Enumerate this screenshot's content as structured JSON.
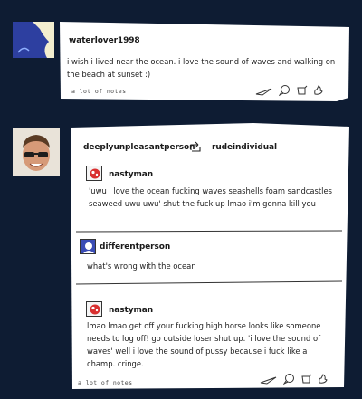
{
  "post1": {
    "username": "waterlover1998",
    "text": "i wish i lived near the ocean. i love the sound of waves and walking on the beach at sunset :)",
    "notes": "a lot of notes"
  },
  "post2": {
    "reblogger": "deeplyunpleasantperson",
    "source": "rudeindividual",
    "notes": "a lot of notes",
    "comments": [
      {
        "username": "nastyman",
        "text": "'uwu i love the ocean fucking waves seashells foam sandcastles seaweed uwu uwu' shut the fuck up lmao i'm gonna kill you"
      },
      {
        "username": "differentperson",
        "text": "what's wrong with the ocean"
      },
      {
        "username": "nastyman",
        "text": "lmao lmao get off your fucking high horse looks like someone needs to log off! go outside loser shut up. 'i love the sound of waves' well i love the sound of pussy because i fuck like a champ. cringe."
      }
    ]
  },
  "icons": [
    "share-icon",
    "reply-icon",
    "reblog-icon",
    "like-icon",
    "reblog-arrow-icon"
  ],
  "colors": {
    "background": "#0e1c33",
    "card": "#ffffff",
    "avatar_red": "#d93030",
    "avatar_blue": "#2d3fa0"
  }
}
